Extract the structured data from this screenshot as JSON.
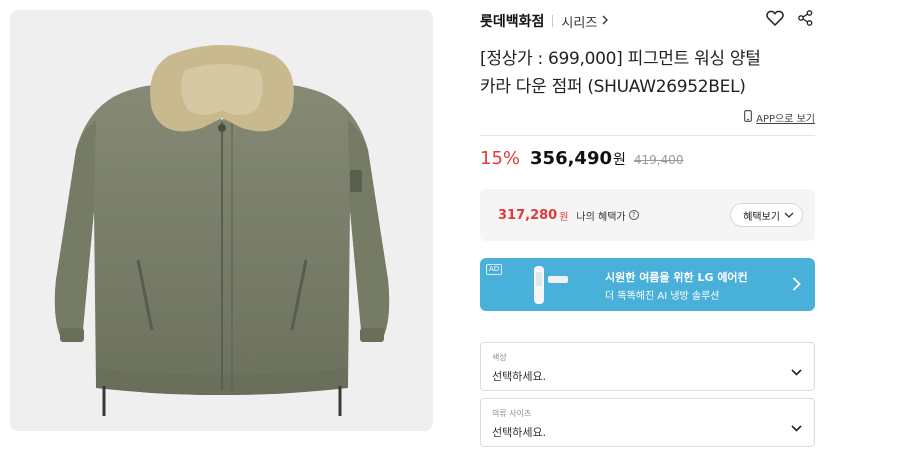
{
  "brand": {
    "name": "롯데백화점",
    "series_label": "시리즈"
  },
  "product": {
    "title_line1": "[정상가 : 699,000] 피그먼트 워싱 양털",
    "title_line2": "카라 다운 점퍼 (SHUAW26952BEL)",
    "app_view_label": "APP으로 보기"
  },
  "price": {
    "discount": "15%",
    "sale_price": "356,490",
    "currency": "원",
    "original_price": "419,400"
  },
  "benefit": {
    "price": "317,280",
    "currency": "원",
    "label": "나의 혜택가",
    "button_label": "혜택보기"
  },
  "ad": {
    "badge": "AD",
    "line1": "시원한 여름을 위한 LG 에어컨",
    "line2": "더 똑똑해진 AI 냉방 솔루션"
  },
  "options": [
    {
      "label": "색상",
      "placeholder": "선택하세요."
    },
    {
      "label": "의류 사이즈",
      "placeholder": "선택하세요."
    }
  ],
  "icons": {
    "wishlist": "heart-icon",
    "share": "share-icon",
    "mobile": "phone-icon",
    "series_chevron": "chevron-right-icon",
    "ad_arrow": "chevron-right-icon",
    "select_chevron": "chevron-down-icon",
    "help": "question-circle-icon"
  },
  "colors": {
    "accent_red": "#e03b3b",
    "ad_blue": "#49b1d9",
    "jacket_khaki": "#7a7f6b",
    "collar_shearling": "#c9b98f"
  }
}
